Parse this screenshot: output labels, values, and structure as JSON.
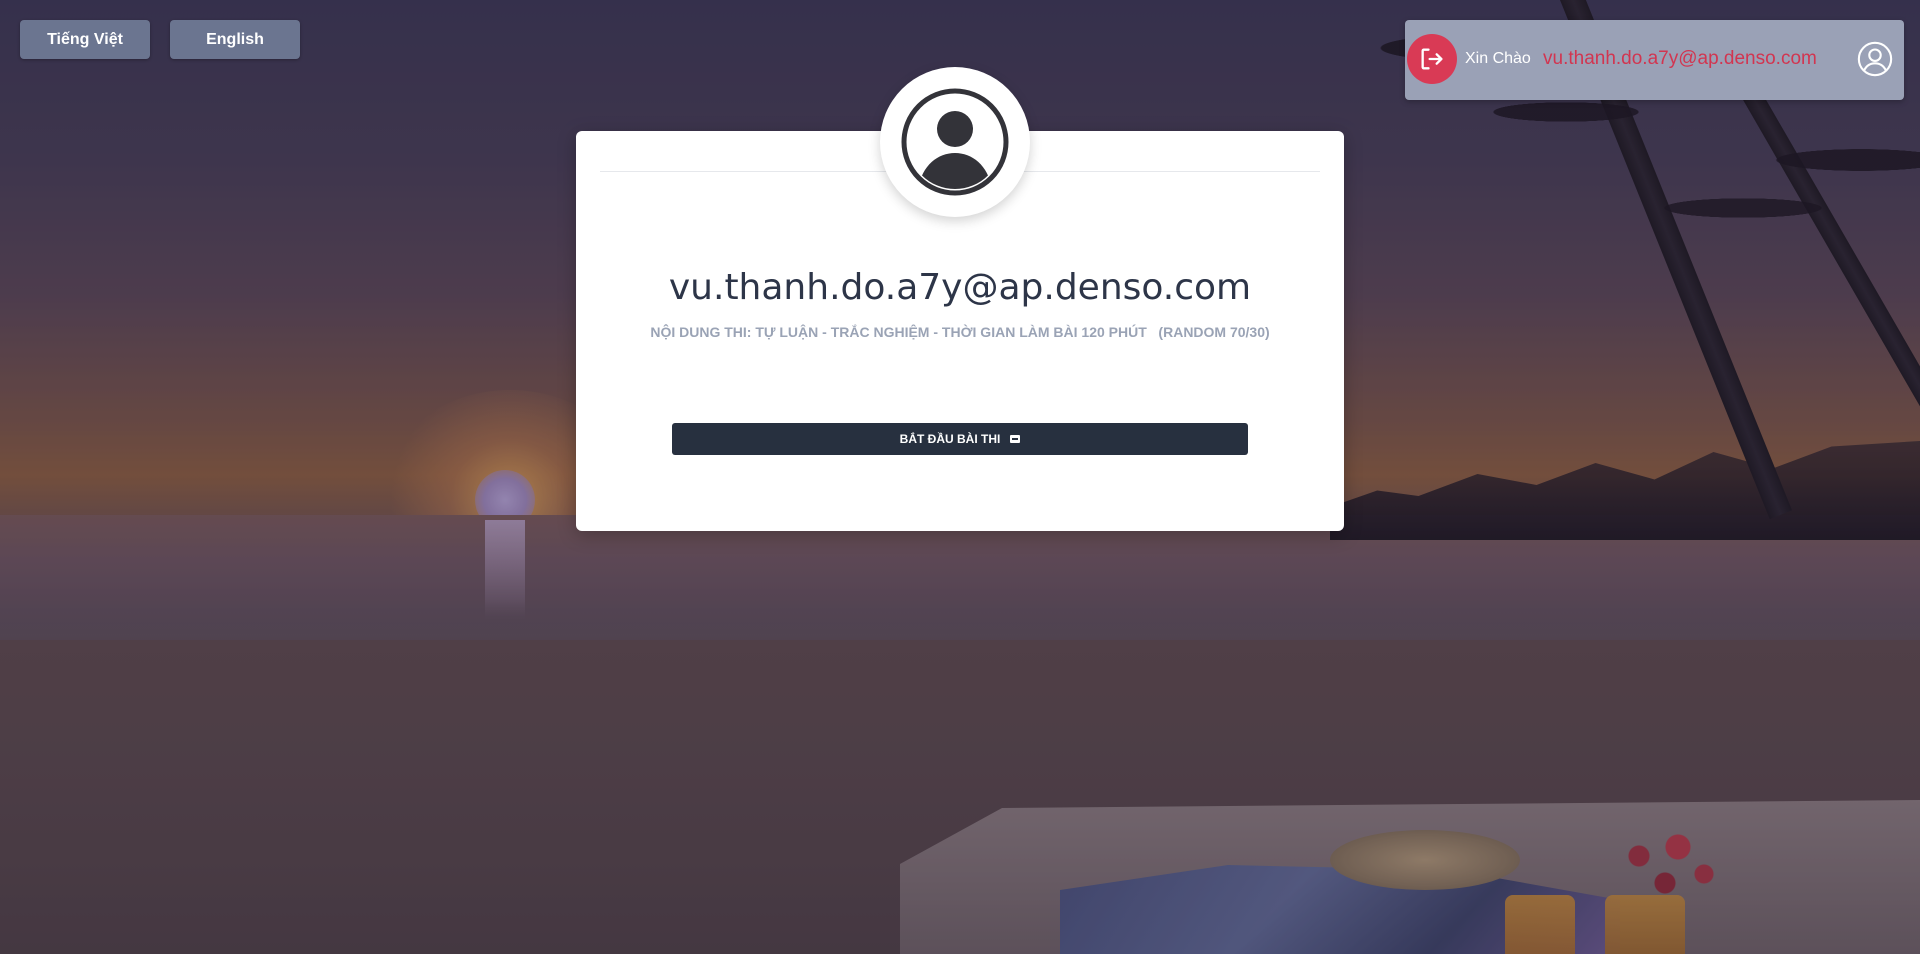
{
  "language_buttons": {
    "vietnamese": "Tiếng Việt",
    "english": "English"
  },
  "user_panel": {
    "greeting": "Xin Chào",
    "email": "vu.thanh.do.a7y@ap.denso.com",
    "logout_icon": "logout-icon",
    "profile_icon": "user-circle-icon"
  },
  "card": {
    "avatar_icon": "user-avatar-icon",
    "title": "vu.thanh.do.a7y@ap.denso.com",
    "subtitle": "NỘI DUNG THI: TỰ LUẬN - TRẮC NGHIỆM - THỜI GIAN LÀM BÀI 120 PHÚT   (RANDOM 70/30)",
    "start_button": "BẮT ĐẦU BÀI THI"
  },
  "colors": {
    "accent_red": "#d93a55",
    "button_dark": "#27303f",
    "panel_bg": "#9aa1b6",
    "lang_button_bg": "#6b7590"
  }
}
